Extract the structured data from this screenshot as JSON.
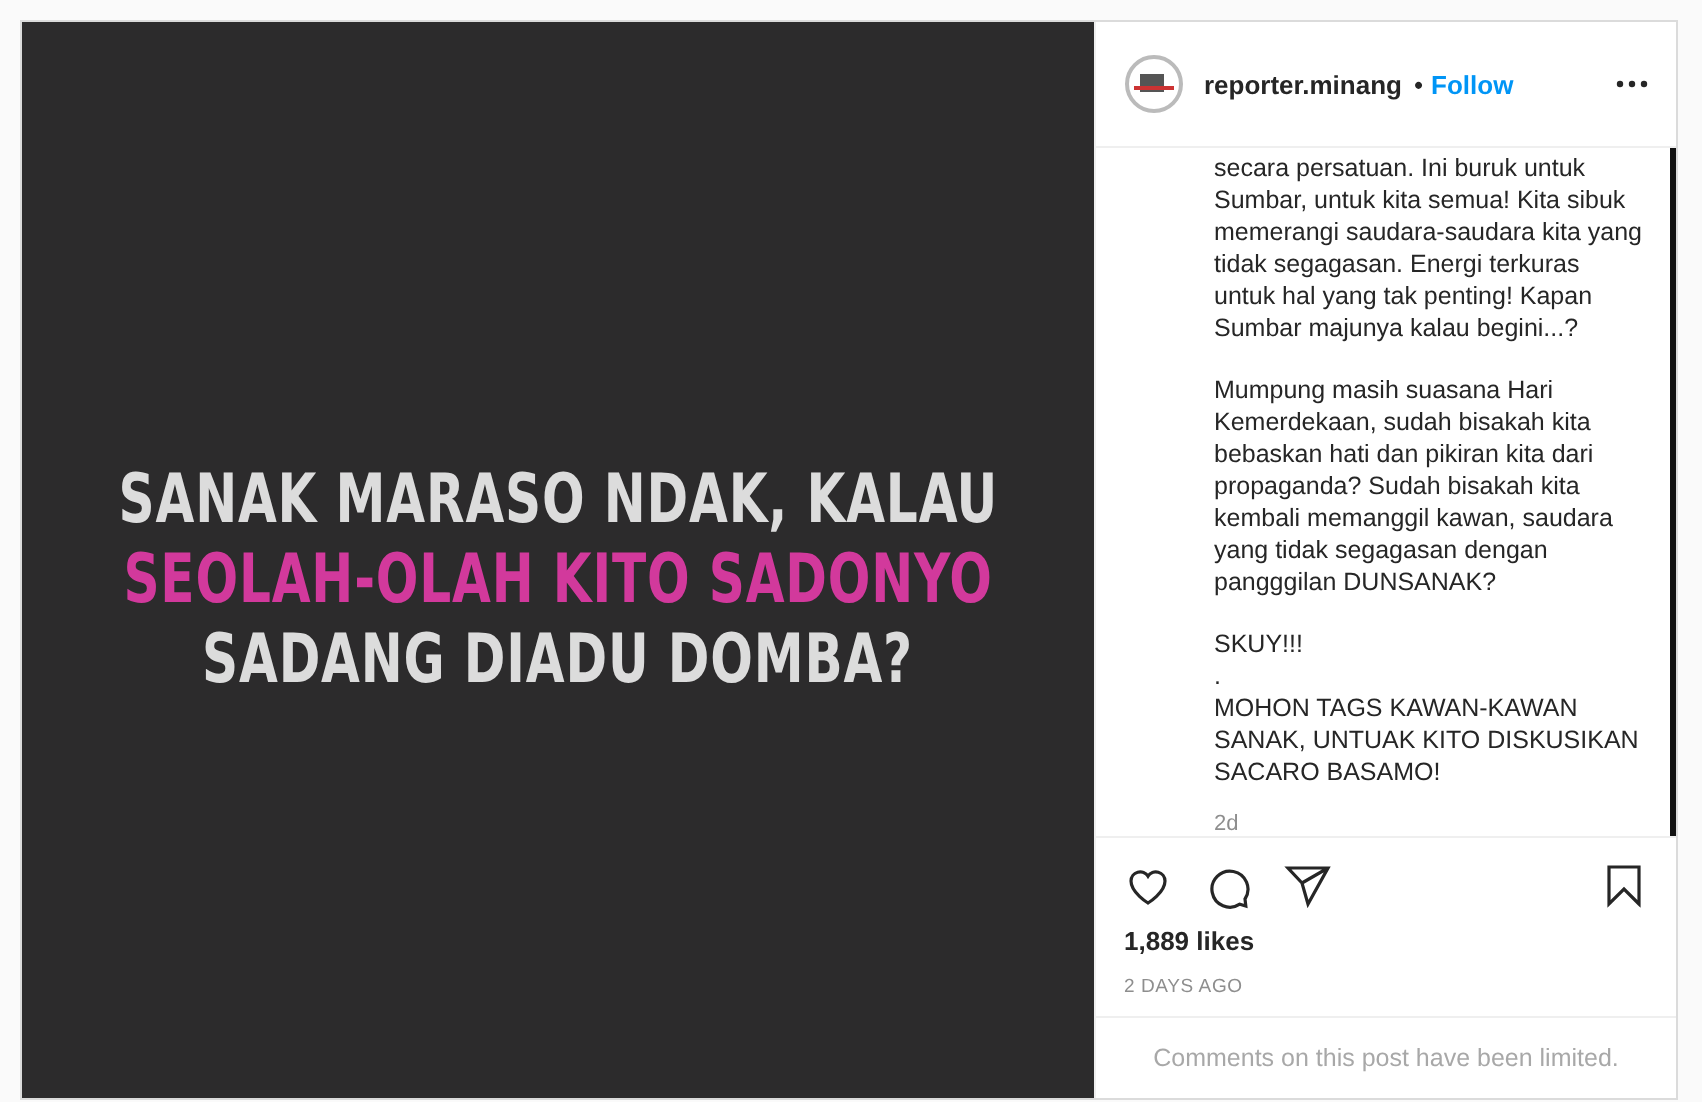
{
  "post_image": {
    "lines": [
      {
        "text": "SANAK MARASO NDAK, KALAU",
        "highlight": false
      },
      {
        "text": "SEOLAH-OLAH KITO SADONYO",
        "highlight": true
      },
      {
        "text": "SADANG DIADU DOMBA?",
        "highlight": false
      }
    ]
  },
  "header": {
    "username": "reporter.minang",
    "separator": "•",
    "follow": "Follow"
  },
  "caption": {
    "paragraphs": [
      [
        "secara persatuan. Ini buruk untuk",
        "Sumbar, untuk kita semua! Kita sibuk",
        "memerangi saudara-saudara kita yang",
        "tidak segagasan. Energi terkuras",
        "untuk hal yang tak penting! Kapan",
        "Sumbar majunya kalau begini...?"
      ],
      [
        "Mumpung masih suasana Hari",
        "Kemerdekaan, sudah bisakah kita",
        "bebaskan hati dan pikiran kita dari",
        "propaganda? Sudah bisakah kita",
        "kembali memanggil kawan, saudara",
        "yang tidak segagasan dengan",
        "pangggilan DUNSANAK?"
      ],
      [
        "SKUY!!!",
        ".",
        "MOHON TAGS KAWAN-KAWAN",
        "SANAK, UNTUAK KITO DISKUSIKAN",
        "SACARO BASAMO!"
      ]
    ],
    "age": "2d"
  },
  "likes": "1,889 likes",
  "date": "2 DAYS AGO",
  "comments_notice": "Comments on this post have been limited."
}
